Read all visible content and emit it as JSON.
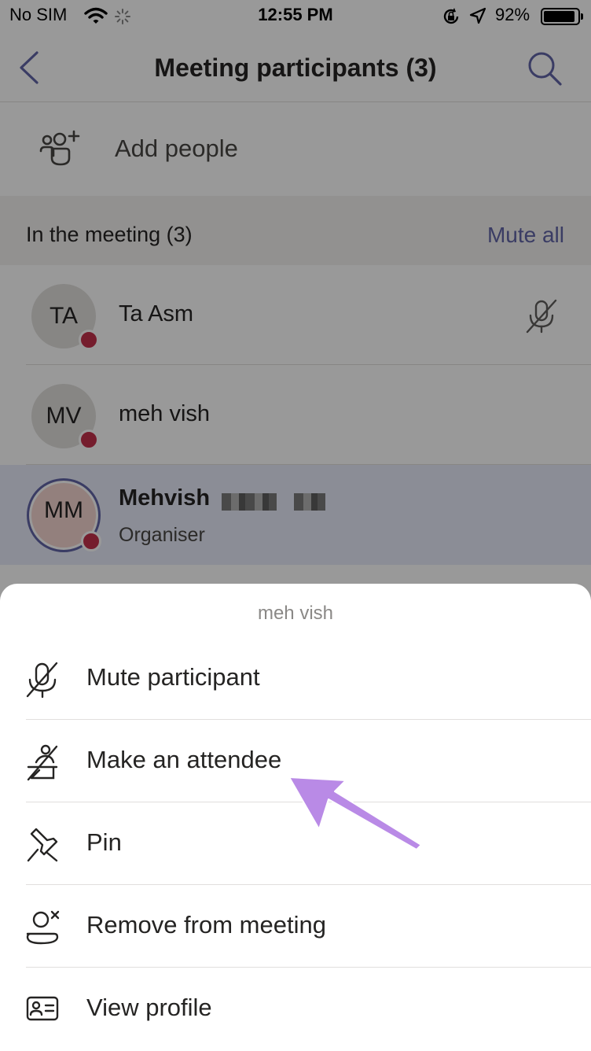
{
  "status_bar": {
    "carrier": "No SIM",
    "time": "12:55 PM",
    "battery_percent": "92%",
    "battery_level": 0.92,
    "icons": [
      "wifi-icon",
      "activity-spinner-icon",
      "rotation-lock-icon",
      "location-arrow-icon",
      "battery-icon"
    ]
  },
  "nav": {
    "title": "Meeting participants (3)",
    "back_icon": "chevron-left-icon",
    "search_icon": "search-icon"
  },
  "add_people": {
    "label": "Add people",
    "icon": "add-people-icon"
  },
  "section": {
    "title": "In the meeting (3)",
    "mute_all": "Mute all"
  },
  "participants": [
    {
      "initials": "TA",
      "name": "Ta Asm",
      "role": "",
      "status": "busy",
      "muted": true
    },
    {
      "initials": "MV",
      "name": "meh vish",
      "role": "",
      "status": "busy",
      "muted": false
    },
    {
      "initials": "MM",
      "name": "Mehvish",
      "role": "Organiser",
      "status": "busy",
      "muted": false
    }
  ],
  "sheet": {
    "title": "meh vish",
    "items": [
      {
        "label": "Mute participant",
        "icon": "mic-off-icon"
      },
      {
        "label": "Make an attendee",
        "icon": "make-attendee-icon"
      },
      {
        "label": "Pin",
        "icon": "pin-icon"
      },
      {
        "label": "Remove from meeting",
        "icon": "remove-person-icon"
      },
      {
        "label": "View profile",
        "icon": "contact-card-icon"
      }
    ]
  },
  "colors": {
    "accent": "#6264a7",
    "presence_busy": "#c4314b",
    "annotation_arrow": "#b98ae6"
  }
}
